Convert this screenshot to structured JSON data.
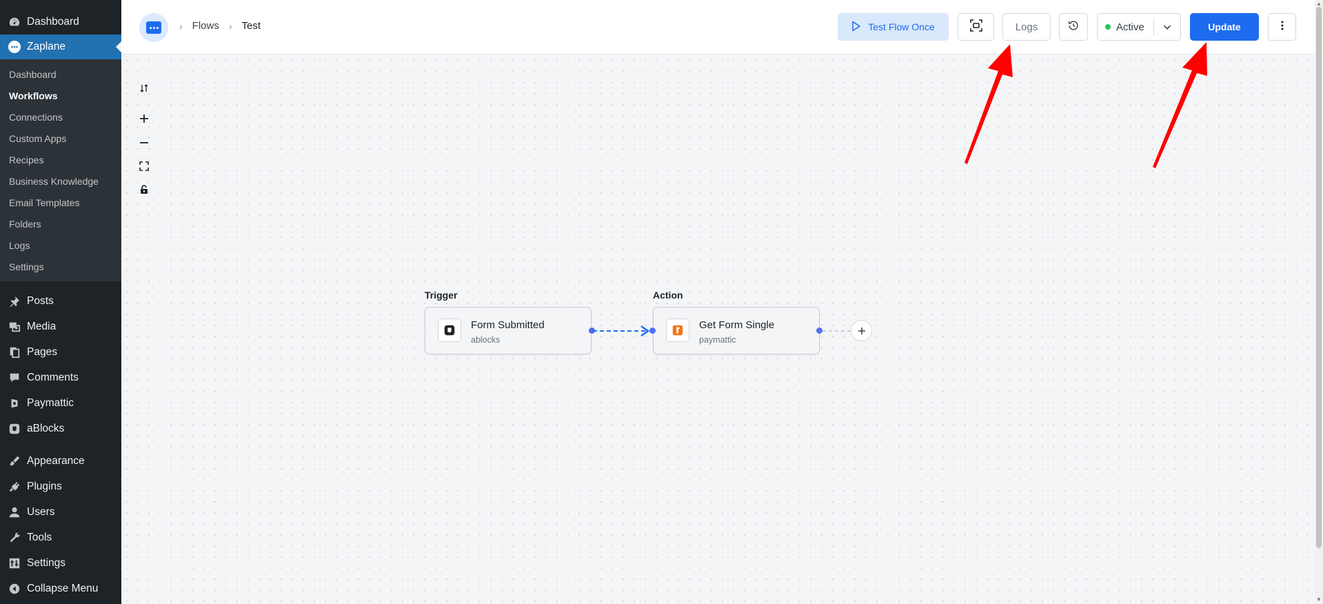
{
  "sidebar": {
    "top_items": [
      {
        "label": "Dashboard",
        "icon": "dashboard-icon"
      },
      {
        "label": "Zaplane",
        "icon": "zaplane-icon",
        "current": true
      }
    ],
    "sub_items": [
      "Dashboard",
      "Workflows",
      "Connections",
      "Custom Apps",
      "Recipes",
      "Business Knowledge",
      "Email Templates",
      "Folders",
      "Logs",
      "Settings"
    ],
    "active_sub": "Workflows",
    "group2": [
      {
        "label": "Posts",
        "icon": "pin-icon"
      },
      {
        "label": "Media",
        "icon": "media-icon"
      },
      {
        "label": "Pages",
        "icon": "pages-icon"
      },
      {
        "label": "Comments",
        "icon": "comment-icon"
      },
      {
        "label": "Paymattic",
        "icon": "paymattic-icon"
      },
      {
        "label": "aBlocks",
        "icon": "ablocks-icon"
      }
    ],
    "group3": [
      {
        "label": "Appearance",
        "icon": "brush-icon"
      },
      {
        "label": "Plugins",
        "icon": "plug-icon"
      },
      {
        "label": "Users",
        "icon": "user-icon"
      },
      {
        "label": "Tools",
        "icon": "wrench-icon"
      },
      {
        "label": "Settings",
        "icon": "settings-icon"
      },
      {
        "label": "Collapse Menu",
        "icon": "collapse-icon"
      }
    ]
  },
  "header": {
    "breadcrumb": [
      "Flows",
      "Test"
    ],
    "test_button": "Test Flow Once",
    "logs_button": "Logs",
    "status": "Active",
    "update_button": "Update"
  },
  "flow": {
    "trigger": {
      "section": "Trigger",
      "title": "Form Submitted",
      "app": "ablocks",
      "icon": "ablocks-logo-icon"
    },
    "action": {
      "section": "Action",
      "title": "Get Form Single",
      "app": "paymattic",
      "icon": "paymattic-logo-icon"
    }
  },
  "colors": {
    "accent": "#1d6cf0",
    "sidebar_bg": "#1d2327",
    "current_menu": "#2271b1",
    "status_dot": "#22c55e",
    "annotation_arrow": "#ff0000"
  }
}
